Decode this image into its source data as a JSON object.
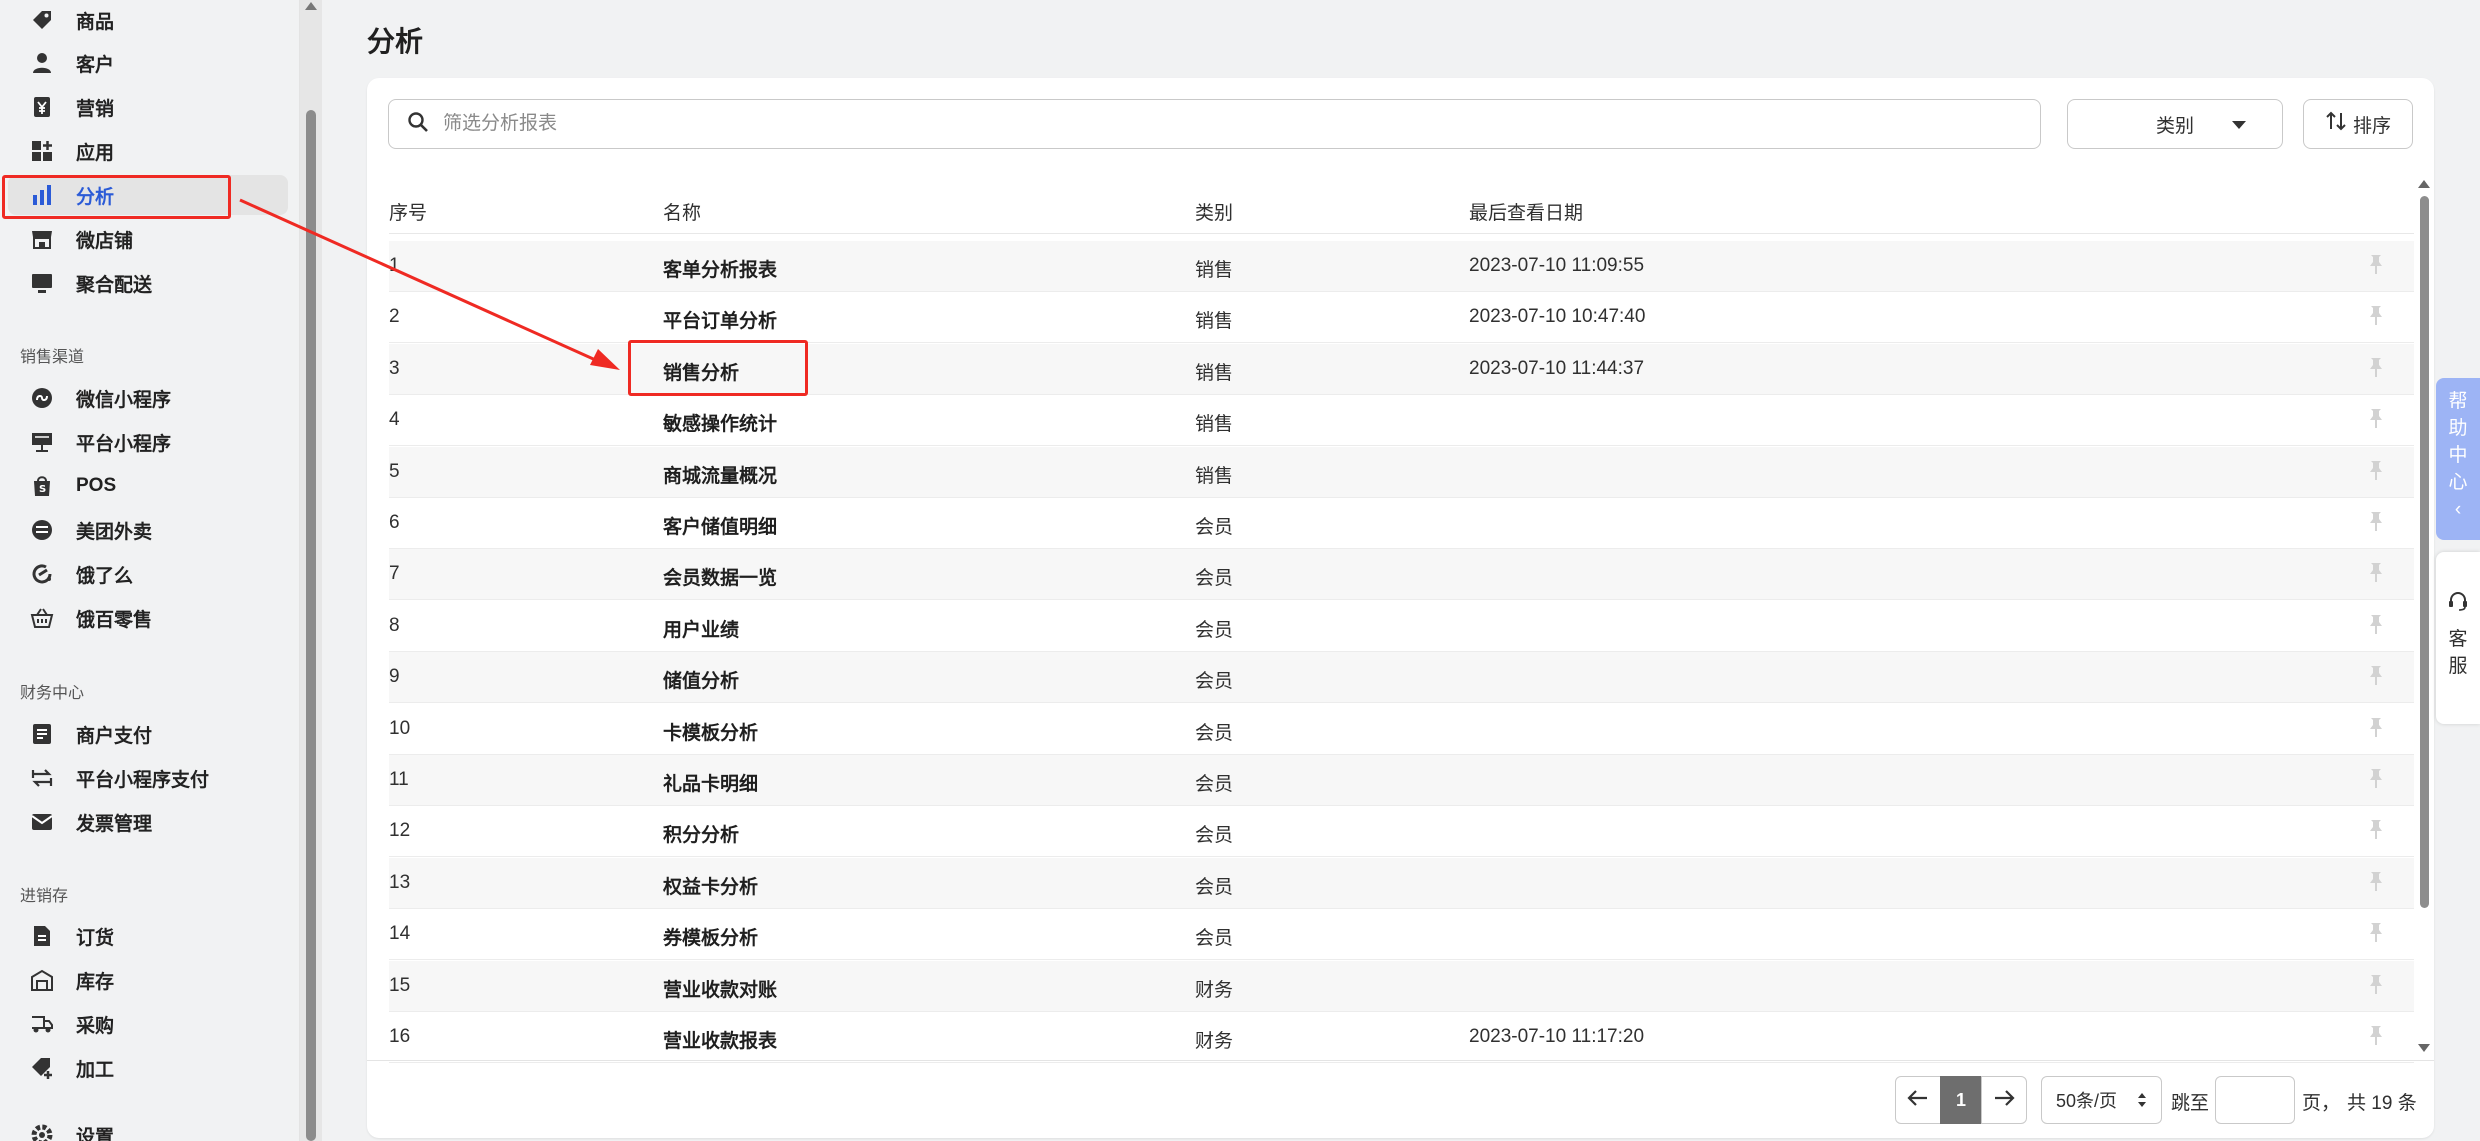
{
  "sidebar": {
    "items_top": [
      {
        "label": "商品",
        "icon": "tag-icon"
      },
      {
        "label": "客户",
        "icon": "user-icon"
      },
      {
        "label": "营销",
        "icon": "coupon-icon"
      },
      {
        "label": "应用",
        "icon": "apps-icon"
      },
      {
        "label": "分析",
        "icon": "bar-chart-icon",
        "active": true
      },
      {
        "label": "微店铺",
        "icon": "store-icon"
      },
      {
        "label": "聚合配送",
        "icon": "monitor-icon"
      }
    ],
    "section_sales": "销售渠道",
    "items_sales": [
      {
        "label": "微信小程序",
        "icon": "miniprogram-icon"
      },
      {
        "label": "平台小程序",
        "icon": "platform-icon"
      },
      {
        "label": "POS",
        "icon": "bag-icon"
      },
      {
        "label": "美团外卖",
        "icon": "meituan-icon"
      },
      {
        "label": "饿了么",
        "icon": "eleme-icon"
      },
      {
        "label": "饿百零售",
        "icon": "basket-icon"
      }
    ],
    "section_finance": "财务中心",
    "items_finance": [
      {
        "label": "商户支付",
        "icon": "receipt-icon"
      },
      {
        "label": "平台小程序支付",
        "icon": "exchange-icon"
      },
      {
        "label": "发票管理",
        "icon": "mail-icon"
      }
    ],
    "section_inventory": "进销存",
    "items_inventory": [
      {
        "label": "订货",
        "icon": "document-icon"
      },
      {
        "label": "库存",
        "icon": "warehouse-icon"
      },
      {
        "label": "采购",
        "icon": "truck-icon"
      },
      {
        "label": "加工",
        "icon": "tag-plus-icon"
      },
      {
        "label": "设置",
        "icon": "gear-icon"
      }
    ]
  },
  "page": {
    "title": "分析",
    "search_placeholder": "筛选分析报表",
    "category_label": "类别",
    "sort_label": "排序"
  },
  "table": {
    "headers": [
      "序号",
      "名称",
      "类别",
      "最后查看日期"
    ],
    "rows": [
      {
        "no": "1",
        "name": "客单分析报表",
        "category": "销售",
        "date": "2023-07-10 11:09:55"
      },
      {
        "no": "2",
        "name": "平台订单分析",
        "category": "销售",
        "date": "2023-07-10 10:47:40"
      },
      {
        "no": "3",
        "name": "销售分析",
        "category": "销售",
        "date": "2023-07-10 11:44:37"
      },
      {
        "no": "4",
        "name": "敏感操作统计",
        "category": "销售",
        "date": ""
      },
      {
        "no": "5",
        "name": "商城流量概况",
        "category": "销售",
        "date": ""
      },
      {
        "no": "6",
        "name": "客户储值明细",
        "category": "会员",
        "date": ""
      },
      {
        "no": "7",
        "name": "会员数据一览",
        "category": "会员",
        "date": ""
      },
      {
        "no": "8",
        "name": "用户业绩",
        "category": "会员",
        "date": ""
      },
      {
        "no": "9",
        "name": "储值分析",
        "category": "会员",
        "date": ""
      },
      {
        "no": "10",
        "name": "卡模板分析",
        "category": "会员",
        "date": ""
      },
      {
        "no": "11",
        "name": "礼品卡明细",
        "category": "会员",
        "date": ""
      },
      {
        "no": "12",
        "name": "积分分析",
        "category": "会员",
        "date": ""
      },
      {
        "no": "13",
        "name": "权益卡分析",
        "category": "会员",
        "date": ""
      },
      {
        "no": "14",
        "name": "券模板分析",
        "category": "会员",
        "date": ""
      },
      {
        "no": "15",
        "name": "营业收款对账",
        "category": "财务",
        "date": ""
      },
      {
        "no": "16",
        "name": "营业收款报表",
        "category": "财务",
        "date": "2023-07-10 11:17:20"
      }
    ]
  },
  "pagination": {
    "current_page": "1",
    "page_size": "50条/页",
    "jump_label": "跳至",
    "page_suffix": "页，",
    "total": "共 19 条"
  },
  "float": {
    "help": [
      "帮",
      "助",
      "中",
      "心",
      "‹"
    ],
    "service": [
      "客",
      "服"
    ]
  },
  "colors": {
    "accent": "#2b5bd7",
    "annotation": "#ef2a23",
    "help_bg": "#9db4f5"
  }
}
